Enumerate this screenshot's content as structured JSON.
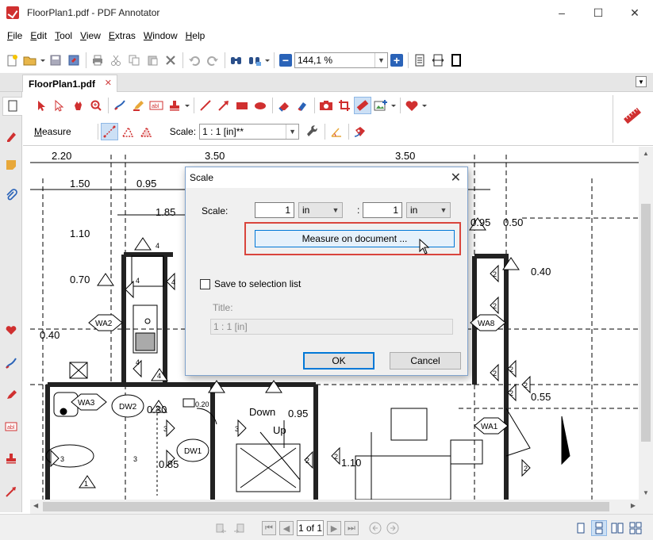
{
  "window": {
    "title": "FloorPlan1.pdf - PDF Annotator",
    "minimize_glyph": "–",
    "maximize_glyph": "☐",
    "close_glyph": "✕"
  },
  "menu": {
    "items": [
      {
        "key": "F",
        "rest": "ile"
      },
      {
        "key": "E",
        "rest": "dit"
      },
      {
        "key": "T",
        "rest": "ool"
      },
      {
        "key": "V",
        "rest": "iew"
      },
      {
        "key": "E",
        "rest": "xtras"
      },
      {
        "key": "W",
        "rest": "indow"
      },
      {
        "key": "H",
        "rest": "elp"
      }
    ]
  },
  "toolbar": {
    "zoom_value": "144,1 %",
    "zoom_minus": "−",
    "zoom_plus": "+"
  },
  "tabs": {
    "document_tab": "FloorPlan1.pdf",
    "tab_close": "✕"
  },
  "annotation_toolbar": {
    "measure_key": "M",
    "measure_rest": "easure",
    "scale_label": "Scale:",
    "scale_value": "1 : 1 [in]**"
  },
  "floorplan": {
    "dimensions": [
      "2.20",
      "3.50",
      "3.50",
      "1.50",
      "0.95",
      "1.85",
      "1.10",
      "0.70",
      "0.40",
      "0.95",
      "0.50",
      "0.40",
      "0.55",
      "0.30",
      "0.95",
      "0.85",
      "1.10",
      "0.20"
    ],
    "labels": [
      "WA2",
      "WA3",
      "DW2",
      "DW1",
      "WA8",
      "WA1",
      "Down",
      "Up"
    ],
    "numbers": [
      "4",
      "4",
      "4",
      "4",
      "4",
      "2",
      "2",
      "2",
      "3",
      "3",
      "3",
      "3",
      "2",
      "2",
      "2",
      "2",
      "2",
      "2",
      "1",
      "2"
    ]
  },
  "statusbar": {
    "page_field": "1 of 1"
  },
  "dialog": {
    "title": "Scale",
    "close_glyph": "✕",
    "scale_label": "Scale:",
    "left_value": "1",
    "left_unit": "in",
    "separator": ":",
    "right_value": "1",
    "right_unit": "in",
    "measure_button": "Measure on document ...",
    "save_checkbox_label": "Save to selection list",
    "title_label": "Title:",
    "title_value": "1 : 1 [in]",
    "ok_button": "OK",
    "cancel_button": "Cancel"
  },
  "colors": {
    "accent_blue": "#0078d7",
    "highlight_red": "#d9453d",
    "annotation_red": "#d03030"
  }
}
